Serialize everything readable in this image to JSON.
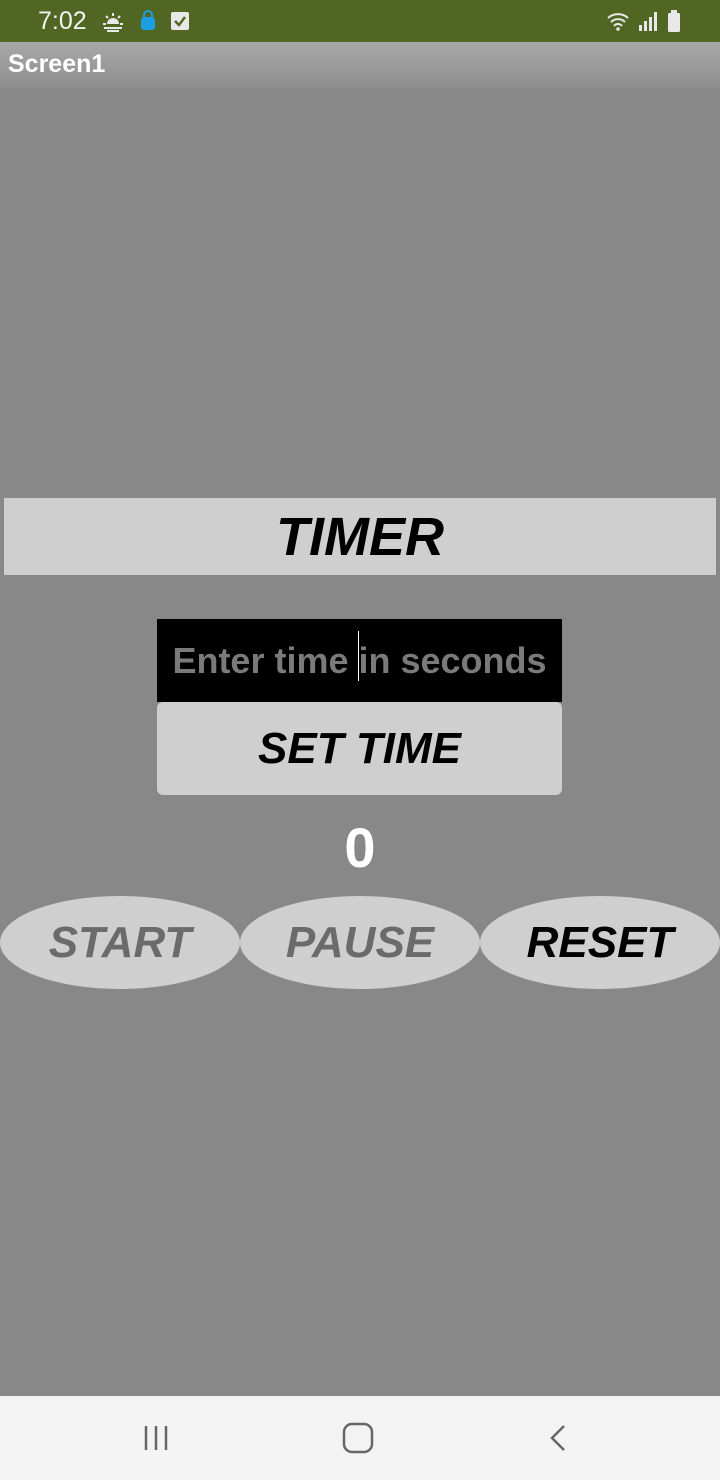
{
  "status_bar": {
    "time": "7:02",
    "icons": [
      "weather-icon",
      "bag-icon",
      "checkbox-notification-icon",
      "wifi-icon",
      "signal-icon",
      "battery-icon"
    ],
    "background_color": "#516623"
  },
  "app": {
    "title": "Screen1",
    "background_color": "#888888"
  },
  "timer": {
    "heading": "TIMER",
    "input_placeholder": "Enter time in seconds",
    "set_time_label": "SET TIME",
    "count": "0",
    "buttons": {
      "start": "START",
      "pause": "PAUSE",
      "reset": "RESET"
    }
  },
  "nav_bar": {
    "icons": [
      "recents-icon",
      "home-icon",
      "back-icon"
    ]
  }
}
